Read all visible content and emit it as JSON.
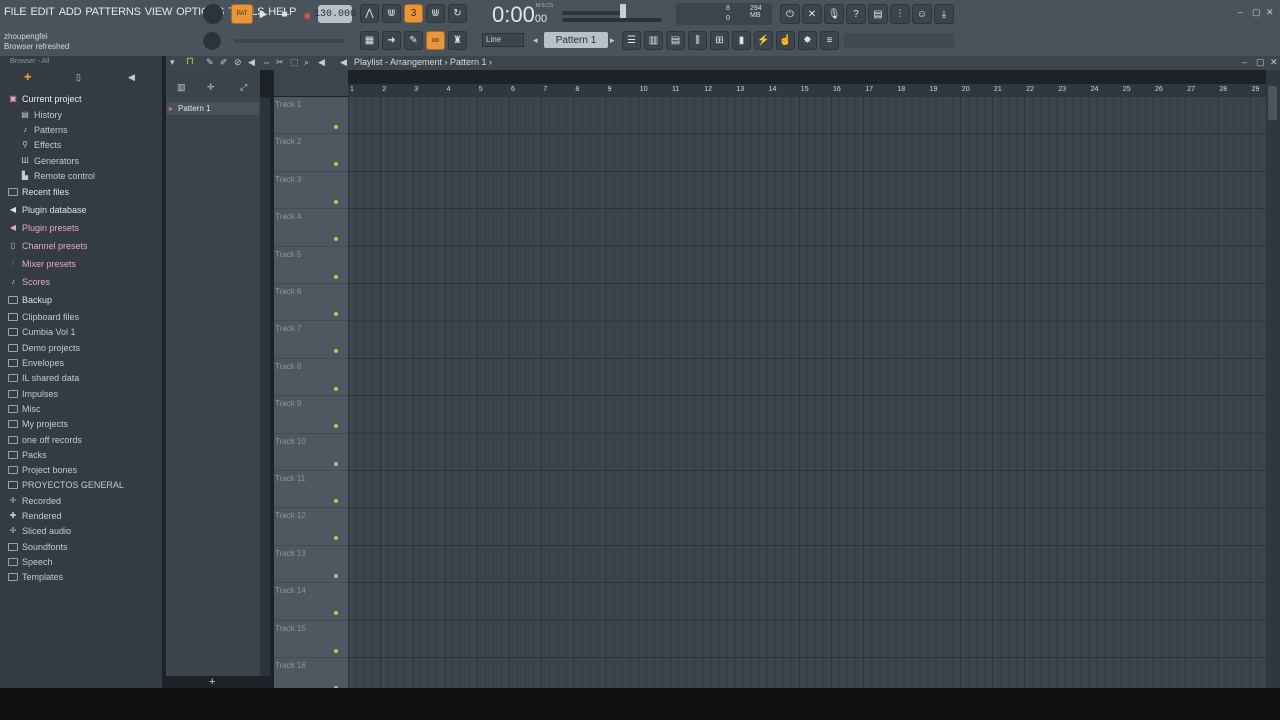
{
  "menu": [
    "FILE",
    "EDIT",
    "ADD",
    "PATTERNS",
    "VIEW",
    "OPTIONS",
    "TOOLS",
    "HELP"
  ],
  "hint": {
    "line1": "zhoupengfei",
    "line2": "Browser refreshed"
  },
  "transport": {
    "mode_label": "PAT",
    "tempo": "130.000",
    "time": "0:00",
    "time_cs": "00",
    "time_unit": "M:S:CS"
  },
  "cpu": {
    "value": "8",
    "poly": "0",
    "memory": "294 MB"
  },
  "toolbar2": {
    "snap": "Line",
    "pattern": "Pattern 1"
  },
  "browser": {
    "header": "Browser - All",
    "items": [
      {
        "label": "Current project",
        "level": "top",
        "icon": "project-icon"
      },
      {
        "label": "History",
        "level": "sub",
        "icon": "history-icon"
      },
      {
        "label": "Patterns",
        "level": "sub",
        "icon": "patterns-icon"
      },
      {
        "label": "Effects",
        "level": "sub",
        "icon": "effects-icon"
      },
      {
        "label": "Generators",
        "level": "sub",
        "icon": "generators-icon"
      },
      {
        "label": "Remote control",
        "level": "sub",
        "icon": "remote-icon"
      },
      {
        "label": "Recent files",
        "level": "cat",
        "icon": "folder-icon"
      },
      {
        "label": "Plugin database",
        "level": "cat",
        "icon": "plugin-icon"
      },
      {
        "label": "Plugin presets",
        "level": "pink",
        "icon": "plugin-preset-icon"
      },
      {
        "label": "Channel presets",
        "level": "pink",
        "icon": "channel-preset-icon"
      },
      {
        "label": "Mixer presets",
        "level": "pink",
        "icon": "mixer-preset-icon"
      },
      {
        "label": "Scores",
        "level": "pink",
        "icon": "score-icon"
      },
      {
        "label": "Backup",
        "level": "cat",
        "icon": "folder-icon"
      },
      {
        "label": "Clipboard files",
        "level": "folder",
        "icon": "folder-icon"
      },
      {
        "label": "Cumbia Vol 1",
        "level": "folder",
        "icon": "folder-icon"
      },
      {
        "label": "Demo projects",
        "level": "folder",
        "icon": "folder-icon"
      },
      {
        "label": "Envelopes",
        "level": "folder",
        "icon": "folder-icon"
      },
      {
        "label": "IL shared data",
        "level": "folder",
        "icon": "folder-icon"
      },
      {
        "label": "Impulses",
        "level": "folder",
        "icon": "folder-icon"
      },
      {
        "label": "Misc",
        "level": "folder",
        "icon": "folder-icon"
      },
      {
        "label": "My projects",
        "level": "folder",
        "icon": "folder-icon"
      },
      {
        "label": "one off records",
        "level": "folder",
        "icon": "folder-icon"
      },
      {
        "label": "Packs",
        "level": "folder",
        "icon": "folder-icon"
      },
      {
        "label": "Project bones",
        "level": "folder",
        "icon": "folder-icon"
      },
      {
        "label": "PROYECTOS GENERAL",
        "level": "folder",
        "icon": "folder-icon"
      },
      {
        "label": "Recorded",
        "level": "folder",
        "icon": "recorded-icon"
      },
      {
        "label": "Rendered",
        "level": "folder",
        "icon": "rendered-icon"
      },
      {
        "label": "Sliced audio",
        "level": "folder",
        "icon": "sliced-icon"
      },
      {
        "label": "Soundfonts",
        "level": "folder",
        "icon": "folder-icon"
      },
      {
        "label": "Speech",
        "level": "folder",
        "icon": "folder-icon"
      },
      {
        "label": "Templates",
        "level": "folder",
        "icon": "folder-icon"
      }
    ]
  },
  "picker": {
    "pattern": "Pattern 1",
    "add": "+"
  },
  "playlist": {
    "title": "Playlist - Arrangement › Pattern 1 ›",
    "bars": [
      "1",
      "2",
      "3",
      "4",
      "5",
      "6",
      "7",
      "8",
      "9",
      "10",
      "11",
      "12",
      "13",
      "14",
      "15",
      "16",
      "17",
      "18",
      "19",
      "20",
      "21",
      "22",
      "23",
      "24",
      "25",
      "26",
      "27",
      "28",
      "29"
    ],
    "tracks": [
      "Track 1",
      "Track 2",
      "Track 3",
      "Track 4",
      "Track 5",
      "Track 6",
      "Track 7",
      "Track 8",
      "Track 9",
      "Track 10",
      "Track 11",
      "Track 12",
      "Track 13",
      "Track 14",
      "Track 15",
      "Track 16"
    ]
  },
  "colors": {
    "accent": "#e8963a",
    "track_led": "#a7d24a",
    "pink": "#e4a9c7"
  }
}
